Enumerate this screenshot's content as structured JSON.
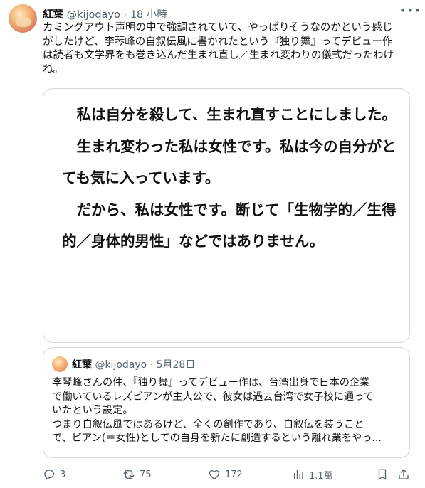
{
  "tweet": {
    "author_name": "紅葉",
    "handle": "@kijodayo",
    "separator": "·",
    "time": "18 小時",
    "text_lines": [
      "カミングアウト声明の中で強調されていて、やっぱりそうなのかという感じ",
      "がしたけど、李琴峰の自叙伝風に書かれたという『独り舞』ってデビュー作",
      "は読者も文学界をも巻き込んだ生まれ直し／生まれ変わりの儀式だったわけ",
      "ね。"
    ]
  },
  "media_image": {
    "paragraphs": [
      "私は自分を殺して、生まれ直すことにしました。",
      "生まれ変わった私は女性です。私は今の自分がとても気に入っています。",
      "だから、私は女性です。断じて「生物学的／生得的／身体的男性」などではありません。"
    ]
  },
  "quoted_tweet": {
    "author_name": "紅葉",
    "handle": "@kijodayo",
    "separator": "·",
    "date": "5月28日",
    "text_lines": [
      "李琴峰さんの件、『独り舞』ってデビュー作は、台湾出身で日本の企業",
      "で働いているレズビアンが主人公で、彼女は過去台湾で女子校に通って",
      "いたという設定。",
      "つまり自叙伝風ではあるけど、全くの創作であり、自叙伝を装うこと",
      "で、ビアン(＝女性)としての自身を新たに創造するという離れ業をやっ..."
    ]
  },
  "actions": {
    "reply_count": "3",
    "retweet_count": "75",
    "like_count": "172",
    "views_count": "1.1萬"
  },
  "icons": {
    "more": "more-icon",
    "reply": "reply-icon",
    "retweet": "retweet-icon",
    "like": "like-icon",
    "views": "views-icon",
    "bookmark": "bookmark-icon",
    "share": "share-icon"
  }
}
